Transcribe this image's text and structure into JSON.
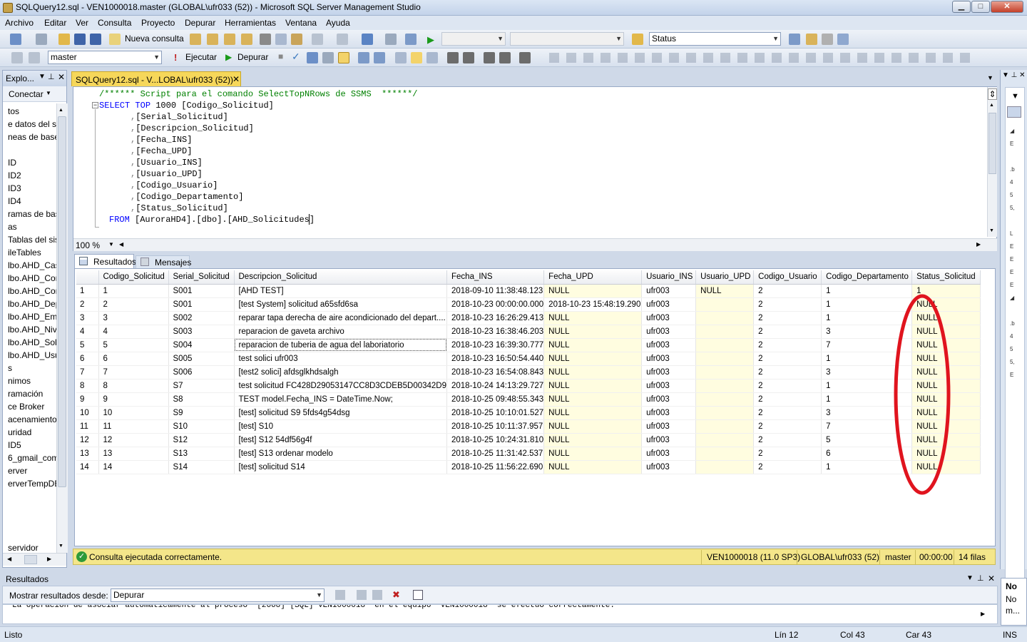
{
  "window": {
    "title": "SQLQuery12.sql - VEN1000018.master (GLOBAL\\ufr033 (52)) - Microsoft SQL Server Management Studio",
    "min": "▁",
    "max": "□",
    "close": "✕"
  },
  "menu": [
    "Archivo",
    "Editar",
    "Ver",
    "Consulta",
    "Proyecto",
    "Depurar",
    "Herramientas",
    "Ventana",
    "Ayuda"
  ],
  "toolbar1": {
    "new_query": "Nueva consulta",
    "status_combo": "Status"
  },
  "toolbar2": {
    "database": "master",
    "execute": "Ejecutar",
    "debug": "Depurar"
  },
  "explorer": {
    "title": "Explo...",
    "connect": "Conectar",
    "items": [
      "tos",
      "e datos del sis",
      "neas de bases",
      "",
      "ID",
      "ID2",
      "ID3",
      "ID4",
      "ramas de bas",
      "as",
      "Tablas del sist",
      "ileTables",
      "lbo.AHD_Cas",
      "lbo.AHD_Cor",
      "lbo.AHD_Cor",
      "lbo.AHD_Dep",
      "lbo.AHD_Emj",
      "lbo.AHD_Niv",
      "lbo.AHD_Soli",
      "lbo.AHD_Usu",
      "s",
      "nimos",
      "ramación",
      "ce Broker",
      "acenamiento",
      "uridad",
      "ID5",
      "6_gmail_com",
      "erver",
      "erverTempDE",
      "",
      "",
      "",
      "",
      "servidor"
    ]
  },
  "doc_tab": {
    "label": "SQLQuery12.sql - V...LOBAL\\ufr033 (52))",
    "close": "✕"
  },
  "editor": {
    "comment": "/****** Script para el comando SelectTopNRows de SSMS  ******/",
    "select_kw": "SELECT",
    "top_kw": "TOP",
    "top_rest": " 1000 [Codigo_Solicitud]",
    "columns": [
      "[Serial_Solicitud]",
      "[Descripcion_Solicitud]",
      "[Fecha_INS]",
      "[Fecha_UPD]",
      "[Usuario_INS]",
      "[Usuario_UPD]",
      "[Codigo_Usuario]",
      "[Codigo_Departamento]",
      "[Status_Solicitud]"
    ],
    "from_kw": "FROM",
    "from_rest": " [AuroraHD4].[dbo].[AHD_Solicitudes]",
    "zoom": "100 %"
  },
  "results_tabs": {
    "results": "Resultados",
    "messages": "Mensajes"
  },
  "grid": {
    "columns": [
      "Codigo_Solicitud",
      "Serial_Solicitud",
      "Descripcion_Solicitud",
      "Fecha_INS",
      "Fecha_UPD",
      "Usuario_INS",
      "Usuario_UPD",
      "Codigo_Usuario",
      "Codigo_Departamento",
      "Status_Solicitud"
    ],
    "rows": [
      [
        "1",
        "1",
        "S001",
        "[AHD TEST]",
        "2018-09-10 11:38:48.123",
        "NULL",
        "ufr003",
        "NULL",
        "2",
        "1",
        "1"
      ],
      [
        "2",
        "2",
        "S001",
        "[test System] solicitud a65sfd6sa",
        "2018-10-23 00:00:00.000",
        "2018-10-23 15:48:19.290",
        "ufr003",
        "",
        "2",
        "1",
        "NULL"
      ],
      [
        "3",
        "3",
        "S002",
        "reparar tapa derecha de aire acondicionado del depart....",
        "2018-10-23 16:26:29.413",
        "NULL",
        "ufr003",
        "",
        "2",
        "1",
        "NULL"
      ],
      [
        "4",
        "4",
        "S003",
        "reparacion de gaveta  archivo",
        "2018-10-23 16:38:46.203",
        "NULL",
        "ufr003",
        "",
        "2",
        "3",
        "NULL"
      ],
      [
        "5",
        "5",
        "S004",
        "reparacion de tuberia de agua del laboriatorio",
        "2018-10-23 16:39:30.777",
        "NULL",
        "ufr003",
        "",
        "2",
        "7",
        "NULL"
      ],
      [
        "6",
        "6",
        "S005",
        "test solici ufr003",
        "2018-10-23 16:50:54.440",
        "NULL",
        "ufr003",
        "",
        "2",
        "1",
        "NULL"
      ],
      [
        "7",
        "7",
        "S006",
        "[test2 solici]  afdsglkhdsalgh",
        "2018-10-23 16:54:08.843",
        "NULL",
        "ufr003",
        "",
        "2",
        "3",
        "NULL"
      ],
      [
        "8",
        "8",
        "S7",
        "test solicitud FC428D29053147CC8D3CDEB5D00342D9",
        "2018-10-24 14:13:29.727",
        "NULL",
        "ufr003",
        "",
        "2",
        "1",
        "NULL"
      ],
      [
        "9",
        "9",
        "S8",
        "TEST model.Fecha_INS = DateTime.Now;",
        "2018-10-25 09:48:55.343",
        "NULL",
        "ufr003",
        "",
        "2",
        "1",
        "NULL"
      ],
      [
        "10",
        "10",
        "S9",
        "[test] solicitud S9  5fds4g54dsg",
        "2018-10-25 10:10:01.527",
        "NULL",
        "ufr003",
        "",
        "2",
        "3",
        "NULL"
      ],
      [
        "11",
        "11",
        "S10",
        "[test] S10",
        "2018-10-25 10:11:37.957",
        "NULL",
        "ufr003",
        "",
        "2",
        "7",
        "NULL"
      ],
      [
        "12",
        "12",
        "S12",
        "[test] S12   54df56g4f",
        "2018-10-25 10:24:31.810",
        "NULL",
        "ufr003",
        "",
        "2",
        "5",
        "NULL"
      ],
      [
        "13",
        "13",
        "S13",
        "[test]  S13  ordenar modelo",
        "2018-10-25 11:31:42.537",
        "NULL",
        "ufr003",
        "",
        "2",
        "6",
        "NULL"
      ],
      [
        "14",
        "14",
        "S14",
        "[test] solicitud S14",
        "2018-10-25 11:56:22.690",
        "NULL",
        "ufr003",
        "",
        "2",
        "1",
        "NULL"
      ]
    ]
  },
  "query_status": {
    "message": "Consulta ejecutada correctamente.",
    "server": "VEN1000018 (11.0 SP3)",
    "login": "GLOBAL\\ufr033 (52)",
    "db": "master",
    "time": "00:00:00",
    "rows": "14 filas"
  },
  "output": {
    "title": "Resultados",
    "show_label": "Mostrar resultados desde:",
    "source": "Depurar",
    "text": "La operación de asociar automáticamente al proceso '[2668] [SQL] VEN1000018' en el equipo 'VEN1000018' se efectuó correctamente."
  },
  "right_panel": {
    "l1": "No",
    "l2": "No",
    "l3": "m..."
  },
  "statusbar": {
    "ready": "Listo",
    "line": "Lín 12",
    "col": "Col 43",
    "char": "Car 43",
    "mode": "INS"
  },
  "colors": {
    "accent": "#f6d75a",
    "annotation": "#e0141e",
    "keyword": "#0000ff",
    "comment": "#008000",
    "null_cell": "#fffde0"
  }
}
